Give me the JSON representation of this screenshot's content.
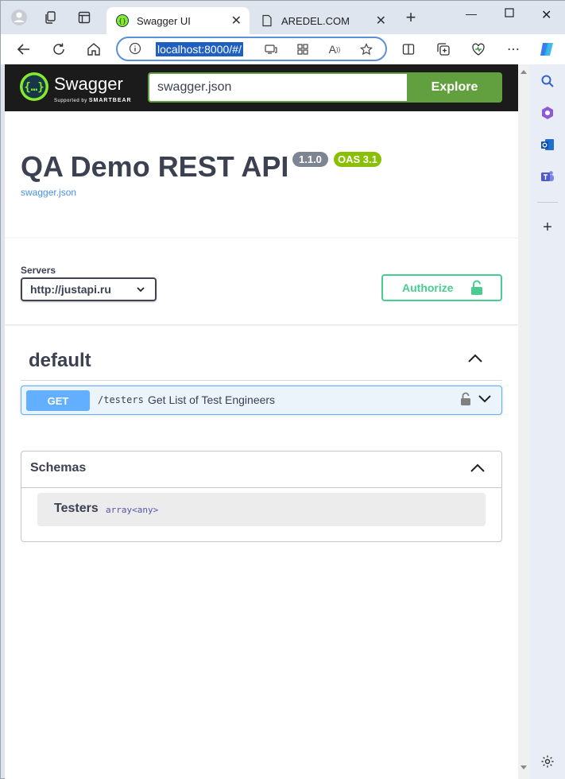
{
  "browser": {
    "tabs": [
      {
        "label": "Swagger UI",
        "active": true
      },
      {
        "label": "AREDEL.COM",
        "active": false
      }
    ],
    "address": {
      "url": "localhost:8000/#/"
    }
  },
  "swagger": {
    "brand": "Swagger",
    "supported_by": "Supported by",
    "smartbear": "SMARTBEAR",
    "spec_input": "swagger.json",
    "explore_label": "Explore"
  },
  "info": {
    "title": "QA Demo REST API",
    "version": "1.1.0",
    "oas": "OAS 3.1",
    "spec_link": "swagger.json"
  },
  "servers": {
    "label": "Servers",
    "selected": "http://justapi.ru",
    "authorize_label": "Authorize"
  },
  "tag": {
    "name": "default",
    "operations": [
      {
        "method": "GET",
        "path": "/testers",
        "summary": "Get List of Test Engineers"
      }
    ]
  },
  "schemas": {
    "title": "Schemas",
    "models": [
      {
        "name": "Testers",
        "type": "array<any>"
      }
    ]
  },
  "colors": {
    "swagger_green": "#62a03f",
    "get_blue": "#61affe",
    "authorize_green": "#49cc90",
    "version_badge": "#7d8492",
    "oas_badge": "#89bf04",
    "topbar": "#1b1b1b"
  }
}
